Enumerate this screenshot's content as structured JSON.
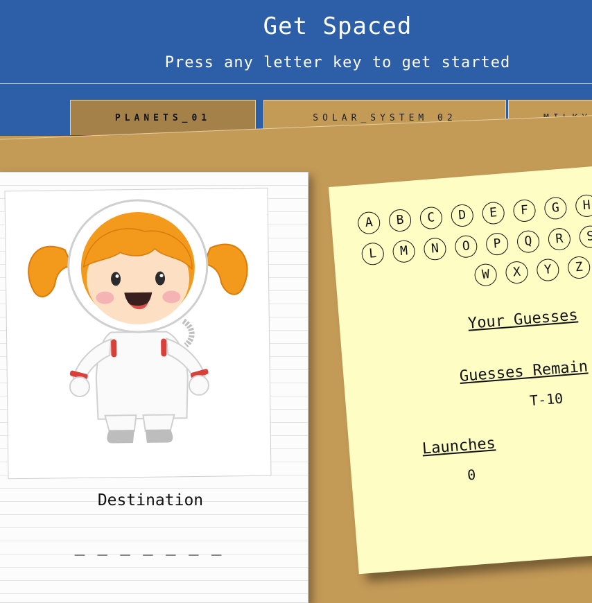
{
  "header": {
    "title": "Get Spaced",
    "subtitle": "Press any letter key to get started"
  },
  "tabs": [
    {
      "label": "PLANETS_01",
      "active": true
    },
    {
      "label": "SOLAR_SYSTEM_02",
      "active": false
    },
    {
      "label": "MILKY",
      "active": false
    }
  ],
  "notebook": {
    "image_icon": "astronaut-girl-illustration",
    "destination_label": "Destination",
    "destination_blanks": "_ _ _ _ _ _ _"
  },
  "note": {
    "letters": [
      "A",
      "B",
      "C",
      "D",
      "E",
      "F",
      "G",
      "H",
      "L",
      "M",
      "N",
      "O",
      "P",
      "Q",
      "R",
      "S",
      "W",
      "X",
      "Y",
      "Z"
    ],
    "your_guesses_label": "Your Guesses",
    "guesses_remaining_label": "Guesses Remain",
    "guesses_remaining_value": "T-10",
    "launches_label": "Launches",
    "launches_value": "0"
  },
  "colors": {
    "header_bg": "#2d5ea8",
    "board_bg": "#c49a57",
    "active_tab": "#a5814a",
    "note_bg": "#fefec4"
  }
}
